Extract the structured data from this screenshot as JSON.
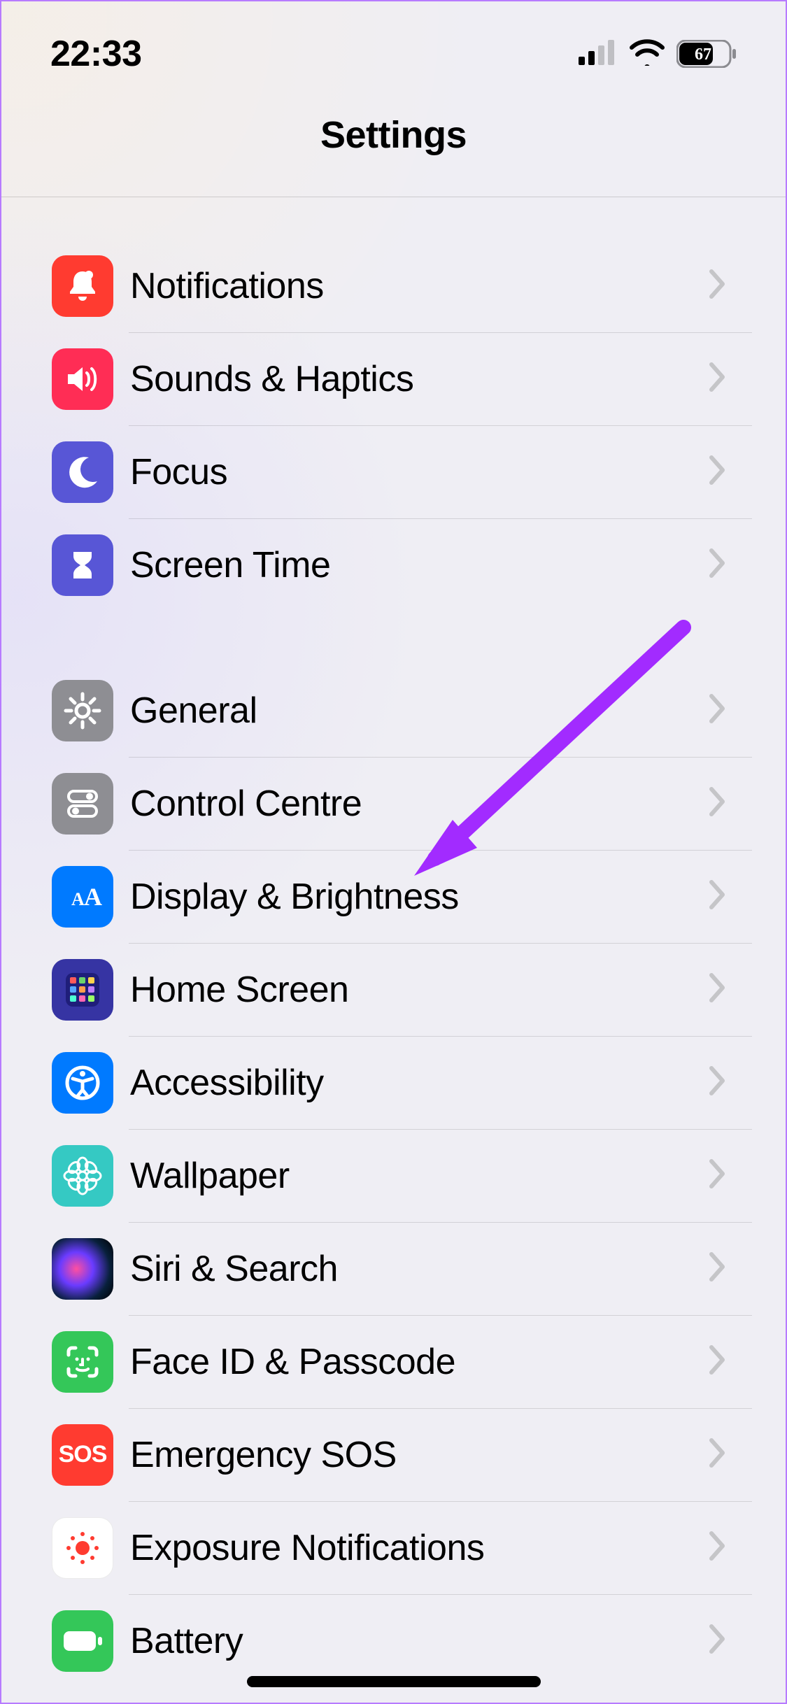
{
  "status": {
    "time": "22:33",
    "battery": "67"
  },
  "nav": {
    "title": "Settings"
  },
  "groups": [
    {
      "rows": [
        {
          "id": "notifications",
          "label": "Notifications",
          "iconClass": "ic-notif",
          "iconName": "bell-icon"
        },
        {
          "id": "sounds",
          "label": "Sounds & Haptics",
          "iconClass": "ic-sound",
          "iconName": "speaker-icon"
        },
        {
          "id": "focus",
          "label": "Focus",
          "iconClass": "ic-focus",
          "iconName": "moon-icon"
        },
        {
          "id": "screentime",
          "label": "Screen Time",
          "iconClass": "ic-screen",
          "iconName": "hourglass-icon"
        }
      ]
    },
    {
      "rows": [
        {
          "id": "general",
          "label": "General",
          "iconClass": "ic-general",
          "iconName": "gear-icon"
        },
        {
          "id": "controlcentre",
          "label": "Control Centre",
          "iconClass": "ic-control",
          "iconName": "switches-icon"
        },
        {
          "id": "display",
          "label": "Display & Brightness",
          "iconClass": "ic-display",
          "iconName": "text-size-icon"
        },
        {
          "id": "homescreen",
          "label": "Home Screen",
          "iconClass": "ic-home",
          "iconName": "app-grid-icon"
        },
        {
          "id": "accessibility",
          "label": "Accessibility",
          "iconClass": "ic-access",
          "iconName": "accessibility-icon"
        },
        {
          "id": "wallpaper",
          "label": "Wallpaper",
          "iconClass": "ic-wall",
          "iconName": "flower-icon"
        },
        {
          "id": "siri",
          "label": "Siri & Search",
          "iconClass": "ic-siri",
          "iconName": "siri-icon"
        },
        {
          "id": "faceid",
          "label": "Face ID & Passcode",
          "iconClass": "ic-faceid",
          "iconName": "faceid-icon"
        },
        {
          "id": "sos",
          "label": "Emergency SOS",
          "iconClass": "ic-sos",
          "iconName": "sos-icon"
        },
        {
          "id": "exposure",
          "label": "Exposure Notifications",
          "iconClass": "ic-expo",
          "iconName": "exposure-icon"
        },
        {
          "id": "battery",
          "label": "Battery",
          "iconClass": "ic-batt",
          "iconName": "battery-icon"
        }
      ]
    }
  ]
}
